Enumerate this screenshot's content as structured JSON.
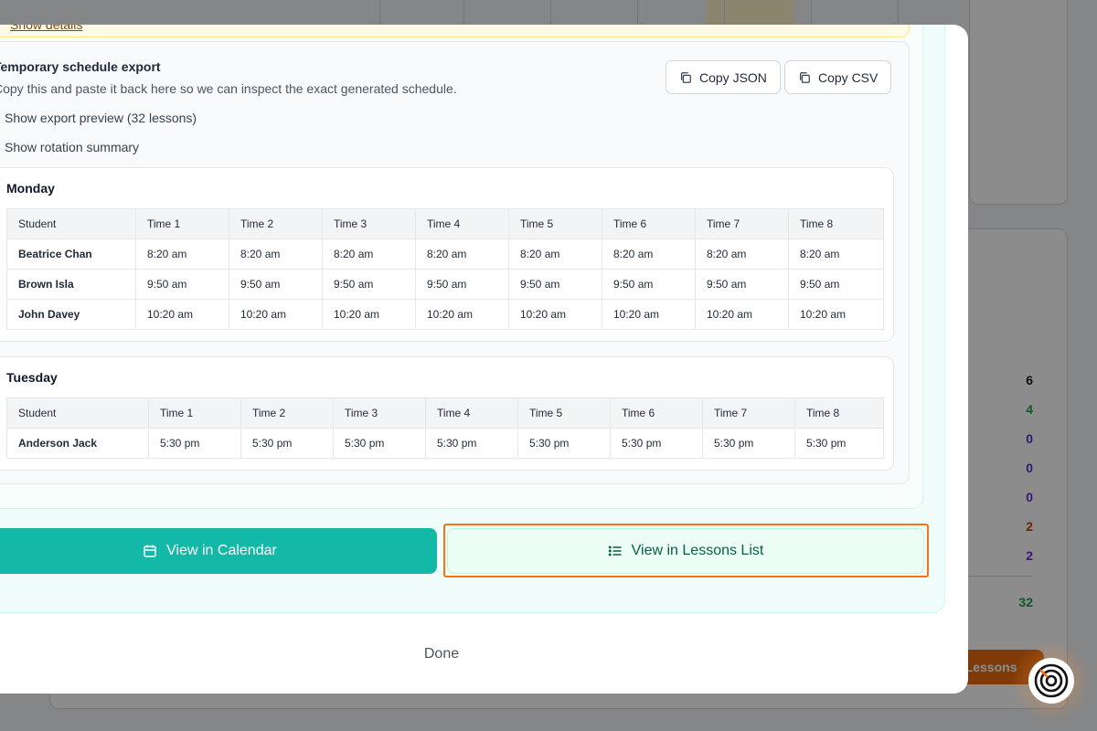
{
  "notice": {
    "show_details": "Show details"
  },
  "export": {
    "title": "Temporary schedule export",
    "subtitle": "Copy this and paste it back here so we can inspect the exact generated schedule.",
    "copy_json": "Copy JSON",
    "copy_csv": "Copy CSV",
    "preview_toggle": "Show export preview (32 lessons)",
    "rotation_toggle": "Show rotation summary"
  },
  "days": [
    {
      "name": "Monday",
      "headers": [
        "Student",
        "Time 1",
        "Time 2",
        "Time 3",
        "Time 4",
        "Time 5",
        "Time 6",
        "Time 7",
        "Time 8"
      ],
      "rows": [
        [
          "Beatrice Chan",
          "8:20 am",
          "8:20 am",
          "8:20 am",
          "8:20 am",
          "8:20 am",
          "8:20 am",
          "8:20 am",
          "8:20 am"
        ],
        [
          "Brown Isla",
          "9:50 am",
          "9:50 am",
          "9:50 am",
          "9:50 am",
          "9:50 am",
          "9:50 am",
          "9:50 am",
          "9:50 am"
        ],
        [
          "John Davey",
          "10:20 am",
          "10:20 am",
          "10:20 am",
          "10:20 am",
          "10:20 am",
          "10:20 am",
          "10:20 am",
          "10:20 am"
        ]
      ]
    },
    {
      "name": "Tuesday",
      "headers": [
        "Student",
        "Time 1",
        "Time 2",
        "Time 3",
        "Time 4",
        "Time 5",
        "Time 6",
        "Time 7",
        "Time 8"
      ],
      "rows": [
        [
          "Anderson Jack",
          "5:30 pm",
          "5:30 pm",
          "5:30 pm",
          "5:30 pm",
          "5:30 pm",
          "5:30 pm",
          "5:30 pm",
          "5:30 pm"
        ]
      ]
    }
  ],
  "actions": {
    "view_calendar": "View in Calendar",
    "view_lessons_list": "View in Lessons List",
    "done": "Done"
  },
  "background": {
    "counts": [
      {
        "value": "6",
        "color": "#111827"
      },
      {
        "value": "4",
        "color": "#16a34a"
      },
      {
        "value": "0",
        "color": "#4338ca"
      },
      {
        "value": "0",
        "color": "#4338ca"
      },
      {
        "value": "0",
        "color": "#6d28d9"
      },
      {
        "value": "2",
        "color": "#c2410c"
      },
      {
        "value": "2",
        "color": "#6d28d9"
      }
    ],
    "total": "32",
    "button_label": "e Lessons"
  },
  "colors": {
    "accent": "#14b8a6",
    "focus": "#f97316",
    "notice_bg": "#fffbe6"
  }
}
